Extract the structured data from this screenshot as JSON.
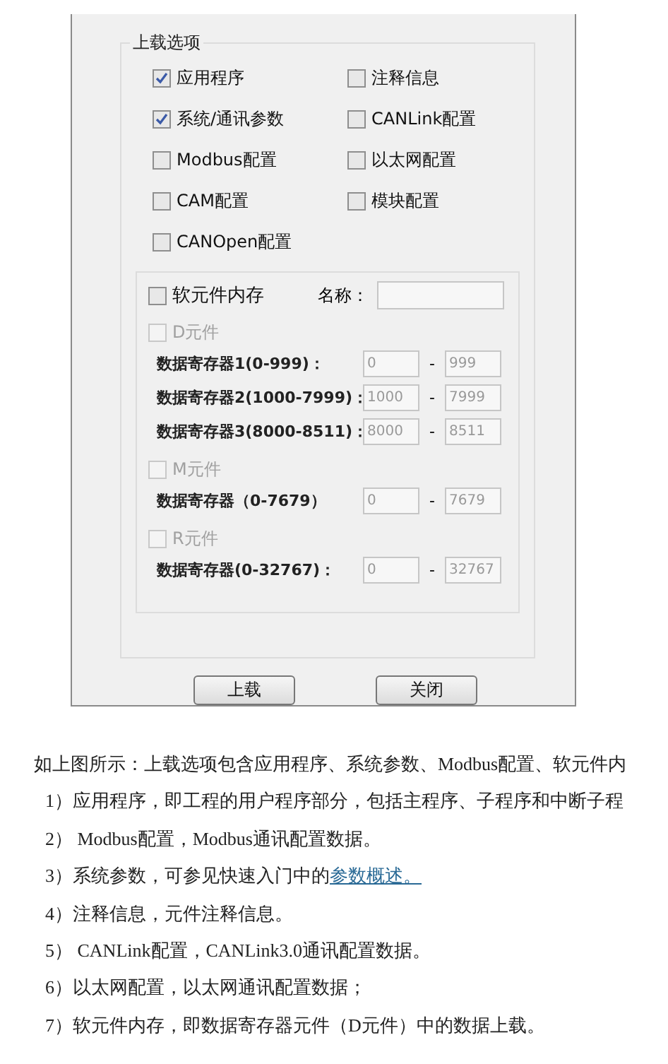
{
  "upload_options": {
    "title": "上载选项",
    "options": [
      {
        "label": "应用程序",
        "checked": true
      },
      {
        "label": "注释信息",
        "checked": false
      },
      {
        "label": "系统/通讯参数",
        "checked": true
      },
      {
        "label": "CANLink配置",
        "checked": false
      },
      {
        "label": "Modbus配置",
        "checked": false
      },
      {
        "label": "以太网配置",
        "checked": false
      },
      {
        "label": "CAM配置",
        "checked": false
      },
      {
        "label": "模块配置",
        "checked": false
      },
      {
        "label": "CANOpen配置",
        "checked": false
      }
    ]
  },
  "memory": {
    "label": "软元件内存",
    "checked": false,
    "name_label": "名称：",
    "groups": [
      {
        "label": "D元件",
        "checked": false,
        "disabled": true,
        "registers": [
          {
            "label": "数据寄存器1(0-999)：",
            "from": "0",
            "separator": "-",
            "to": "999"
          },
          {
            "label": "数据寄存器2(1000-7999)：",
            "from": "1000",
            "separator": "-",
            "to": "7999"
          },
          {
            "label": "数据寄存器3(8000-8511)：",
            "from": "8000",
            "separator": "-",
            "to": "8511"
          }
        ]
      },
      {
        "label": "M元件",
        "checked": false,
        "disabled": true,
        "registers": [
          {
            "label": "数据寄存器（0-7679）",
            "from": "0",
            "separator": "-",
            "to": "7679"
          }
        ]
      },
      {
        "label": "R元件",
        "checked": false,
        "disabled": true,
        "registers": [
          {
            "label": "数据寄存器(0-32767)：",
            "from": "0",
            "separator": "-",
            "to": "32767"
          }
        ]
      }
    ]
  },
  "buttons": [
    {
      "label": "上载"
    },
    {
      "label": "关闭"
    }
  ],
  "article": {
    "intro": "如上图所示：上载选项包含应用程序、系统参数、Modbus配置、软元件内",
    "items": [
      {
        "text": "1）应用程序，即工程的用户程序部分，包括主程序、子程序和中断子程"
      },
      {
        "text": "2）  Modbus配置，Modbus通讯配置数据。"
      },
      {
        "text": "3）系统参数，可参见快速入门中的",
        "link": "参数概述。"
      },
      {
        "text": "4）注释信息，元件注释信息。"
      },
      {
        "text": "5）  CANLink配置，CANLink3.0通讯配置数据。"
      },
      {
        "text": "6）以太网配置，以太网通讯配置数据；"
      },
      {
        "text": "7）软元件内存，即数据寄存器元件（D元件）中的数据上载。"
      }
    ]
  }
}
